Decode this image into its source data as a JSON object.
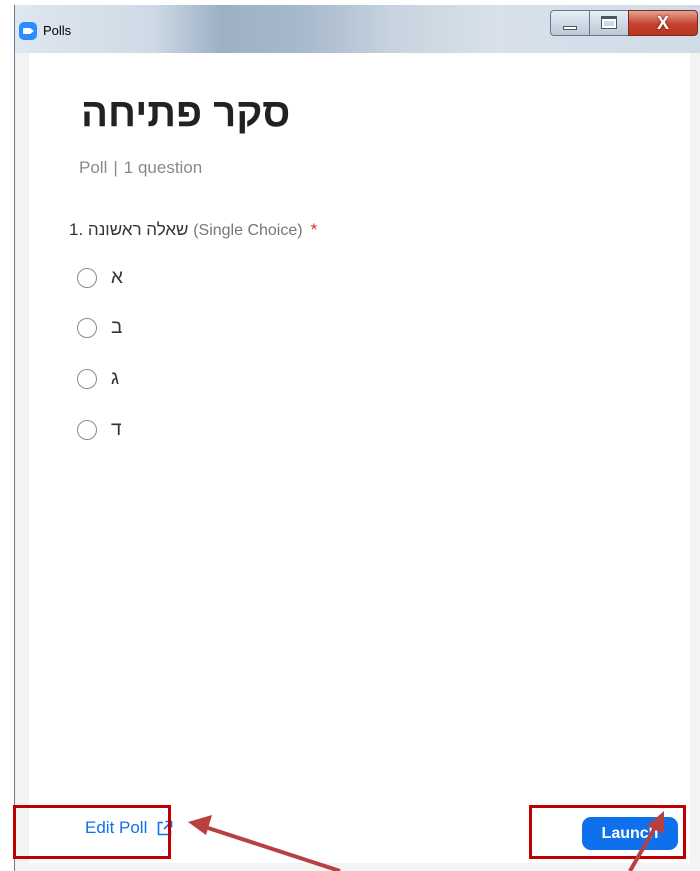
{
  "window": {
    "title": "Polls",
    "close_glyph": "X"
  },
  "poll": {
    "title": "סקר פתיחה",
    "type": "Poll",
    "separator": "|",
    "question_count": "1 question",
    "question": {
      "number": "1.",
      "text": "שאלה ראשונה",
      "type": "(Single Choice)",
      "required_marker": "*",
      "options": [
        "א",
        "ב",
        "ג",
        "ד"
      ]
    }
  },
  "footer": {
    "edit_label": "Edit Poll",
    "launch_label": "Launch"
  },
  "colors": {
    "accent": "#0e71eb",
    "annotation": "#c00000",
    "arrow": "#b84040"
  }
}
